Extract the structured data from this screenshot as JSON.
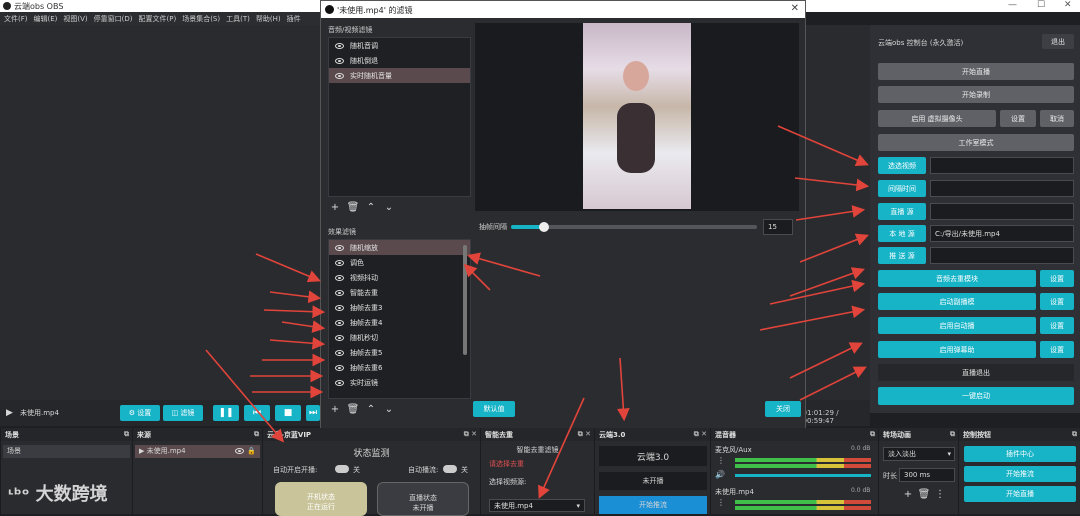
{
  "main_window": {
    "title": "云端obs OBS",
    "controls": [
      "—",
      "☐",
      "✕"
    ]
  },
  "menubar": [
    "文件(F)",
    "编辑(E)",
    "视图(V)",
    "停靠窗口(D)",
    "配置文件(P)",
    "场景集合(S)",
    "工具(T)",
    "帮助(H)",
    "插件"
  ],
  "dialog": {
    "title": "'未使用.mp4' 的滤镜",
    "audio_filters_label": "音频/视频滤镜",
    "audio_filters": [
      {
        "name": "随机音调",
        "selected": false
      },
      {
        "name": "随机倒退",
        "selected": false
      },
      {
        "name": "实时随机音量",
        "selected": true
      }
    ],
    "effect_filters_label": "效果滤镜",
    "effect_filters": [
      {
        "name": "随机缩放",
        "selected": true
      },
      {
        "name": "调色",
        "selected": false
      },
      {
        "name": "视频抖动",
        "selected": false
      },
      {
        "name": "智能去重",
        "selected": false
      },
      {
        "name": "抽帧去重3",
        "selected": false
      },
      {
        "name": "抽帧去重4",
        "selected": false
      },
      {
        "name": "随机秒切",
        "selected": false
      },
      {
        "name": "抽帧去重5",
        "selected": false
      },
      {
        "name": "抽帧去重6",
        "selected": false
      },
      {
        "name": "实时运镜",
        "selected": false
      }
    ],
    "slider_label": "抽帧间隔",
    "slider_value": "15",
    "slider_fraction": 0.05,
    "default_button": "默认值",
    "close_button": "关闭"
  },
  "source_bar": {
    "source_name": "未使用.mp4",
    "settings_button": "设置",
    "filters_button": "滤镜",
    "time": "-01:01:29 / -00:59:47"
  },
  "right_panel": {
    "title": "云端obs 控制台 (永久激活)",
    "logout": "退出",
    "start_stream": "开始直播",
    "start_record": "开始录制",
    "virtual_cam": "启用 虚拟摄像头",
    "vcam_settings": "设置",
    "vcam_stop": "取消",
    "studio_mode": "工作室模式",
    "fields": [
      {
        "label": "选选视频",
        "value": ""
      },
      {
        "label": "间隔时间",
        "value": ""
      },
      {
        "label": "直播 源",
        "value": ""
      },
      {
        "label": "本 地 源",
        "value": "C:/导出/未使用.mp4"
      },
      {
        "label": "推 送 源",
        "value": ""
      }
    ],
    "feature_buttons": [
      {
        "label": "音频去重模块",
        "settings": "设置"
      },
      {
        "label": "启动副播模",
        "settings": "设置"
      },
      {
        "label": "启用自动播",
        "settings": "设置"
      },
      {
        "label": "启用弹幕助",
        "settings": "设置"
      }
    ],
    "exit_label": "直播退出",
    "one_click": "一键启动"
  },
  "docks": {
    "scenes": {
      "title": "场景",
      "items": [
        "场景"
      ]
    },
    "sources": {
      "title": "来源",
      "items": [
        "未使用.mp4"
      ]
    },
    "vip": {
      "title": "云直-京蓝VIP",
      "status_title": "状态监测",
      "auto_start": "自动开启开播:",
      "auto_stop": "自动播流:",
      "toggle_off": "关",
      "card_left": "开机状态\n正在运行",
      "card_right": "直播状态\n未开播"
    },
    "smart": {
      "title": "智能去重",
      "subtitle": "智能去重滤镜",
      "warning": "请选择去重",
      "select_label": "选择视频源:",
      "select_value": "未使用.mp4"
    },
    "cloud": {
      "title": "云端3.0",
      "header": "云端3.0",
      "status": "未开播",
      "start": "开始推流"
    },
    "mixer": {
      "title": "混音器",
      "tracks": [
        {
          "name": "麦克风/Aux",
          "db": "0.0 dB"
        },
        {
          "name": "未使用.mp4",
          "db": "0.0 dB"
        }
      ]
    },
    "transitions": {
      "title": "转场动画",
      "type": "淡入淡出",
      "duration_label": "时长",
      "duration": "300 ms"
    },
    "controls": {
      "title": "控制按钮",
      "buttons": [
        "插件中心",
        "开始推流",
        "开始直播"
      ]
    }
  },
  "watermark": "大数跨境"
}
